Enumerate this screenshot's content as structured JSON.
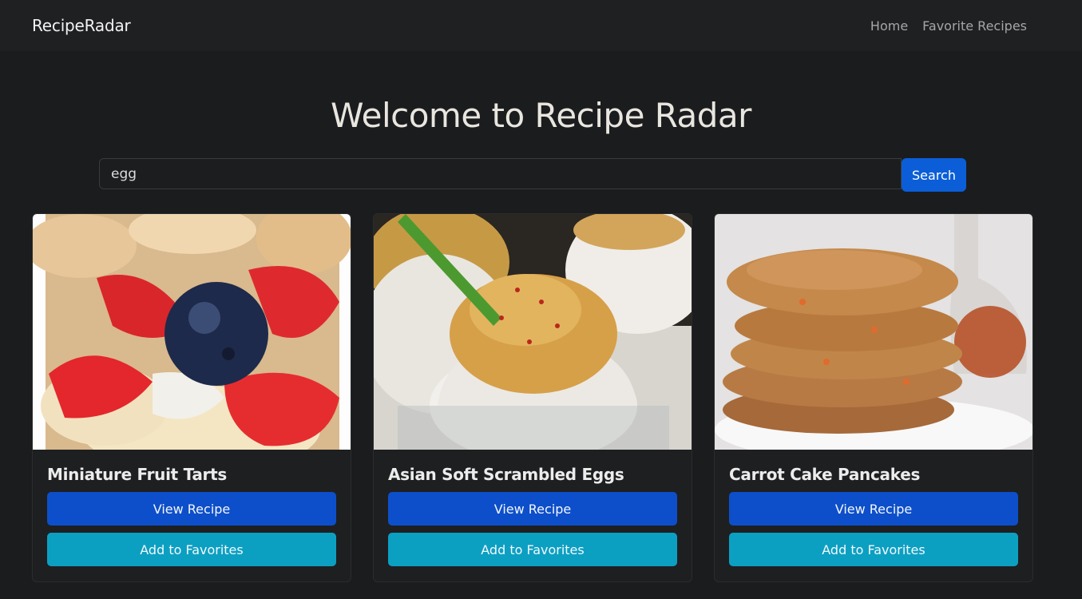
{
  "navbar": {
    "brand": "RecipeRadar",
    "links": [
      "Home",
      "Favorite Recipes"
    ]
  },
  "hero": {
    "title": "Welcome to Recipe Radar"
  },
  "search": {
    "value": "egg",
    "button_label": "Search"
  },
  "recipes": [
    {
      "title": "Miniature Fruit Tarts",
      "view_label": "View Recipe",
      "favorite_label": "Add to Favorites"
    },
    {
      "title": "Asian Soft Scrambled Eggs",
      "view_label": "View Recipe",
      "favorite_label": "Add to Favorites"
    },
    {
      "title": "Carrot Cake Pancakes",
      "view_label": "View Recipe",
      "favorite_label": "Add to Favorites"
    }
  ],
  "colors": {
    "background": "#1b1c1e",
    "primary": "#0d4fca",
    "info": "#0ba0c2"
  }
}
